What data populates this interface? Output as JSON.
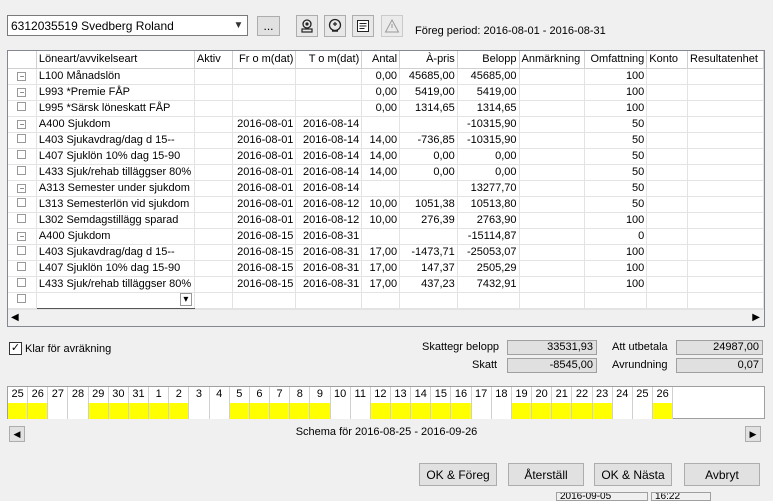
{
  "employee_select": {
    "value": "6312035519   Svedberg Roland"
  },
  "browse_button": "...",
  "period_label": "Föreg period: 2016-08-01 - 2016-08-31",
  "columns": [
    "Löneart/avvikelseart",
    "Aktiv",
    "Fr o m(dat)",
    "T o m(dat)",
    "Antal",
    "À-pris",
    "Belopp",
    "Anmärkning",
    "Omfattning",
    "Konto",
    "Resultatenhet"
  ],
  "rows": [
    {
      "exp": "−",
      "name": "L100 Månadslön",
      "aktiv": "",
      "from": "",
      "tom": "",
      "antal": "0,00",
      "apris": "45685,00",
      "belopp": "45685,00",
      "anm": "",
      "omf": "100",
      "konto": "",
      "res": ""
    },
    {
      "exp": "−",
      "name": "L993 *Premie FÅP",
      "aktiv": "",
      "from": "",
      "tom": "",
      "antal": "0,00",
      "apris": "5419,00",
      "belopp": "5419,00",
      "anm": "",
      "omf": "100",
      "konto": "",
      "res": ""
    },
    {
      "exp": "",
      "name": "L995 *Särsk löneskatt FÅP",
      "aktiv": "",
      "from": "",
      "tom": "",
      "antal": "0,00",
      "apris": "1314,65",
      "belopp": "1314,65",
      "anm": "",
      "omf": "100",
      "konto": "",
      "res": ""
    },
    {
      "exp": "−",
      "name": "A400 Sjukdom",
      "aktiv": "",
      "from": "2016-08-01",
      "tom": "2016-08-14",
      "antal": "",
      "apris": "",
      "belopp": "-10315,90",
      "anm": "",
      "omf": "50",
      "konto": "",
      "res": ""
    },
    {
      "exp": "",
      "name": "L403 Sjukavdrag/dag d 15--",
      "aktiv": "",
      "from": "2016-08-01",
      "tom": "2016-08-14",
      "antal": "14,00",
      "apris": "-736,85",
      "belopp": "-10315,90",
      "anm": "",
      "omf": "50",
      "konto": "",
      "res": ""
    },
    {
      "exp": "",
      "name": "L407 Sjuklön 10% dag 15-90",
      "aktiv": "",
      "from": "2016-08-01",
      "tom": "2016-08-14",
      "antal": "14,00",
      "apris": "0,00",
      "belopp": "0,00",
      "anm": "",
      "omf": "50",
      "konto": "",
      "res": ""
    },
    {
      "exp": "",
      "name": "L433 Sjuk/rehab tilläggser 80%",
      "aktiv": "",
      "from": "2016-08-01",
      "tom": "2016-08-14",
      "antal": "14,00",
      "apris": "0,00",
      "belopp": "0,00",
      "anm": "",
      "omf": "50",
      "konto": "",
      "res": ""
    },
    {
      "exp": "−",
      "name": "A313 Semester under sjukdom",
      "aktiv": "",
      "from": "2016-08-01",
      "tom": "2016-08-14",
      "antal": "",
      "apris": "",
      "belopp": "13277,70",
      "anm": "",
      "omf": "50",
      "konto": "",
      "res": ""
    },
    {
      "exp": "",
      "name": "L313 Semesterlön vid sjukdom",
      "aktiv": "",
      "from": "2016-08-01",
      "tom": "2016-08-12",
      "antal": "10,00",
      "apris": "1051,38",
      "belopp": "10513,80",
      "anm": "",
      "omf": "50",
      "konto": "",
      "res": ""
    },
    {
      "exp": "",
      "name": "L302 Semdagstillägg sparad",
      "aktiv": "",
      "from": "2016-08-01",
      "tom": "2016-08-12",
      "antal": "10,00",
      "apris": "276,39",
      "belopp": "2763,90",
      "anm": "",
      "omf": "100",
      "konto": "",
      "res": ""
    },
    {
      "exp": "−",
      "name": "A400 Sjukdom",
      "aktiv": "",
      "from": "2016-08-15",
      "tom": "2016-08-31",
      "antal": "",
      "apris": "",
      "belopp": "-15114,87",
      "anm": "",
      "omf": "0",
      "konto": "",
      "res": ""
    },
    {
      "exp": "",
      "name": "L403 Sjukavdrag/dag d 15--",
      "aktiv": "",
      "from": "2016-08-15",
      "tom": "2016-08-31",
      "antal": "17,00",
      "apris": "-1473,71",
      "belopp": "-25053,07",
      "anm": "",
      "omf": "100",
      "konto": "",
      "res": ""
    },
    {
      "exp": "",
      "name": "L407 Sjuklön 10% dag 15-90",
      "aktiv": "",
      "from": "2016-08-15",
      "tom": "2016-08-31",
      "antal": "17,00",
      "apris": "147,37",
      "belopp": "2505,29",
      "anm": "",
      "omf": "100",
      "konto": "",
      "res": ""
    },
    {
      "exp": "",
      "name": "L433 Sjuk/rehab tilläggser 80%",
      "aktiv": "",
      "from": "2016-08-15",
      "tom": "2016-08-31",
      "antal": "17,00",
      "apris": "437,23",
      "belopp": "7432,91",
      "anm": "",
      "omf": "100",
      "konto": "",
      "res": ""
    }
  ],
  "checkbox": {
    "label": "Klar för avräkning",
    "checked": true
  },
  "totals": {
    "skattegr_label": "Skattegr belopp",
    "skattegr_value": "33531,93",
    "skatt_label": "Skatt",
    "skatt_value": "-8545,00",
    "att_utbetala_label": "Att utbetala",
    "att_utbetala_value": "24987,00",
    "avrundning_label": "Avrundning",
    "avrundning_value": "0,07"
  },
  "calendar_days": [
    "25",
    "26",
    "27",
    "28",
    "29",
    "30",
    "31",
    "1",
    "2",
    "3",
    "4",
    "5",
    "6",
    "7",
    "8",
    "9",
    "10",
    "11",
    "12",
    "13",
    "14",
    "15",
    "16",
    "17",
    "18",
    "19",
    "20",
    "21",
    "22",
    "23",
    "24",
    "25",
    "26"
  ],
  "calendar_marks": [
    "y",
    "y",
    "w",
    "w",
    "y",
    "y",
    "y",
    "y",
    "y",
    "w",
    "w",
    "y",
    "y",
    "y",
    "y",
    "y",
    "w",
    "w",
    "y",
    "y",
    "y",
    "y",
    "y",
    "w",
    "w",
    "y",
    "y",
    "y",
    "y",
    "y",
    "w",
    "w",
    "y"
  ],
  "schema_label": "Schema för 2016-08-25 - 2016-09-26",
  "buttons": {
    "ok_foreg": "OK & Föreg",
    "aterstall": "Återställ",
    "ok_nasta": "OK & Nästa",
    "avbryt": "Avbryt"
  },
  "status": {
    "date": "2016-09-05",
    "time": "16:22"
  }
}
